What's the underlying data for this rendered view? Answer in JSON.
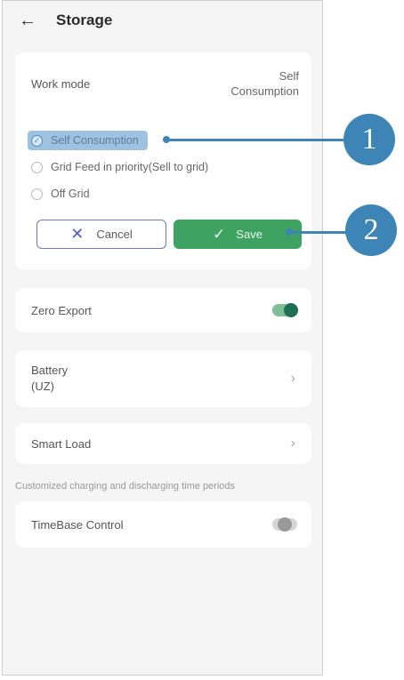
{
  "header": {
    "title": "Storage",
    "back_icon": "arrow-left-icon"
  },
  "work_mode": {
    "label": "Work mode",
    "value_line1": "Self",
    "value_line2": "Consumption",
    "options": [
      {
        "label": "Self Consumption",
        "selected": true
      },
      {
        "label": "Grid Feed in priority(Sell to grid)",
        "selected": false
      },
      {
        "label": "Off Grid",
        "selected": false
      }
    ],
    "cancel_label": "Cancel",
    "save_label": "Save"
  },
  "zero_export": {
    "label": "Zero Export",
    "enabled": true
  },
  "battery": {
    "label_line1": "Battery",
    "label_line2": "(UZ)"
  },
  "smart_load": {
    "label": "Smart Load"
  },
  "hint": "Customized charging and discharging time periods",
  "timebase": {
    "label": "TimeBase Control",
    "enabled": false
  },
  "callouts": [
    {
      "label": "1"
    },
    {
      "label": "2"
    }
  ],
  "colors": {
    "accent_green": "#3ea362",
    "callout_blue": "#3d85b6"
  }
}
